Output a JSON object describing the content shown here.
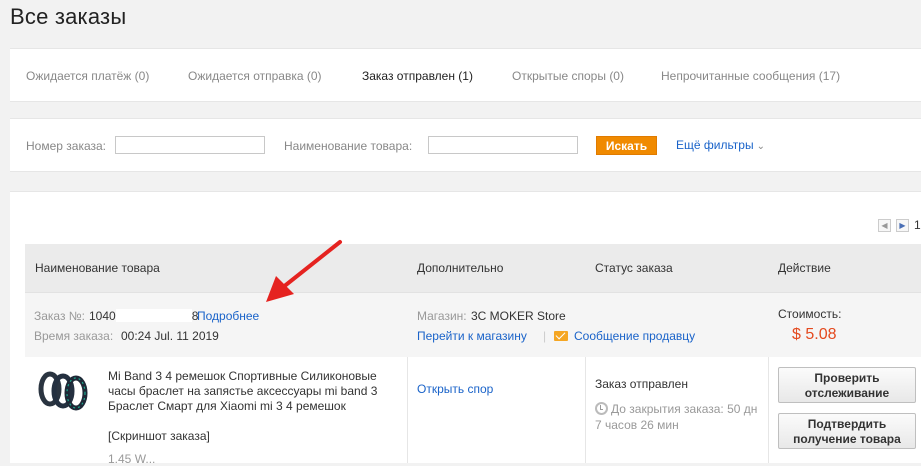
{
  "page": {
    "title": "Все заказы"
  },
  "tabs": [
    {
      "label": "Ожидается платёж (0)"
    },
    {
      "label": "Ожидается отправка (0)"
    },
    {
      "label": "Заказ отправлен (1)"
    },
    {
      "label": "Открытые споры (0)"
    },
    {
      "label": "Непрочитанные сообщения (17)"
    }
  ],
  "filters": {
    "order_number_label": "Номер заказа:",
    "product_name_label": "Наименование товара:",
    "search_button": "Искать",
    "more_filters": "Ещё фильтры"
  },
  "pagination": {
    "current": "1"
  },
  "table": {
    "headers": [
      "Наименование товара",
      "Дополнительно",
      "Статус заказа",
      "Действие"
    ]
  },
  "order": {
    "number_label": "Заказ №:",
    "number_prefix": "1040",
    "number_suffix": "8",
    "details_link": "Подробнее",
    "time_label": "Время заказа:",
    "time_value": "00:24 Jul. 11 2019",
    "store_label": "Магазин:",
    "store_name": "3C MOKER Store",
    "go_to_store": "Перейти к магазину",
    "separator": "|",
    "message_seller": "Сообщение продавцу",
    "cost_label": "Стоимость:",
    "cost_value": "$ 5.08"
  },
  "item": {
    "title": "Mi Band 3 4 ремешок Спортивные Силиконовые часы браслет на запястье аксессуары mi band 3 Браслет Смарт для Xiaomi mi 3 4 ремешок",
    "snapshot": "[Скриншот заказа]",
    "extra": "1.45 W...",
    "open_dispute": "Открыть спор",
    "status": "Заказ отправлен",
    "countdown": "До закрытия заказа: 50 дн 7 часов 26 мин",
    "btn_track": "Проверить отслеживание",
    "btn_confirm": "Подтвердить получение товара"
  },
  "colors": {
    "accent": "#f08a00",
    "link": "#1a63c9",
    "price": "#e4491e",
    "arrow": "#e52320"
  }
}
